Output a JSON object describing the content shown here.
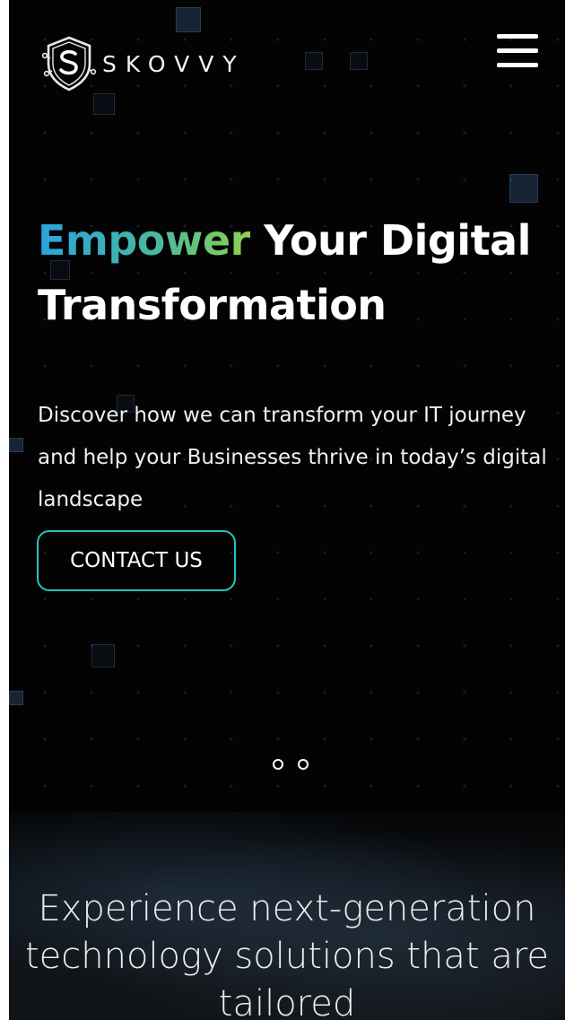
{
  "brand": {
    "name": "SKOVVY",
    "logo_icon": "shield-s-circuit-icon"
  },
  "header": {
    "menu_icon": "hamburger-menu-icon"
  },
  "hero": {
    "title_accent": "Empower",
    "title_rest": " Your Digital Transformation",
    "subtitle": "Discover how we can transform your IT journey and help your Businesses thrive in today’s digital landscape",
    "cta_label": "CONTACT US",
    "slide_count": 2
  },
  "section2": {
    "text": "Experience next-generation technology solutions that are tailored"
  },
  "colors": {
    "background": "#030304",
    "accent_blue": "#2aa4e0",
    "accent_green": "#8fd14f",
    "cta_border": "#27c2bf",
    "text": "#ffffff"
  }
}
